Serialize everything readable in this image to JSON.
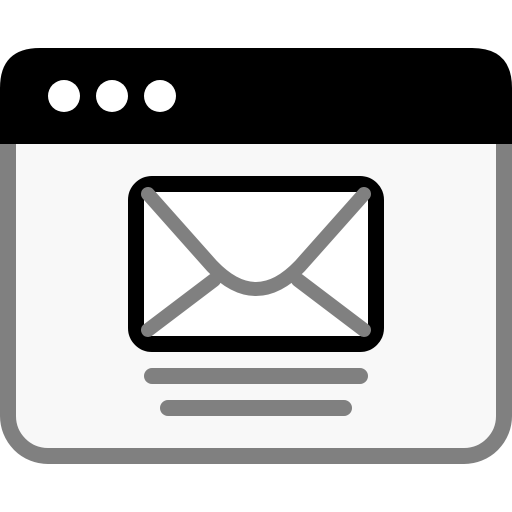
{
  "icon": {
    "name": "email-window-icon",
    "colors": {
      "titlebar": "#000000",
      "window_outline": "#808080",
      "window_fill": "#f8f8f8",
      "window_dots": "#ffffff",
      "envelope_outline": "#000000",
      "envelope_lines": "#808080",
      "text_lines": "#808080"
    }
  }
}
